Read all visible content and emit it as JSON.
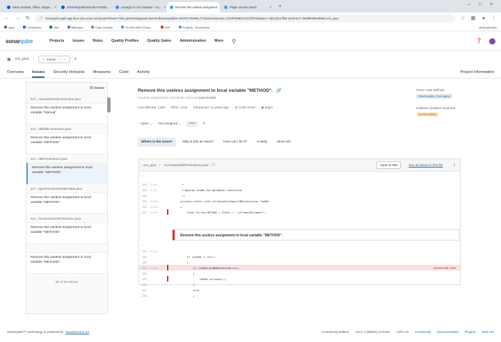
{
  "browser": {
    "tabs": [
      {
        "label": "WEKI Outlook, Office, Skype...",
        "color": "#0b57d0"
      },
      {
        "label": "SONARQUBE-IMAGE-P12654 -",
        "color": "#0b57d0"
      },
      {
        "label": "sonarjdo is not complete - Go...",
        "color": "#4285f4"
      },
      {
        "label": "Remove this useless assignmen...",
        "color": "#4b9fd5"
      },
      {
        "label": "Plugin version matrix",
        "color": "#4b9fd5"
      }
    ],
    "url": "sonarqube.apps.apg-dev1-sp1.amat.com/project/issues?clea=java%20&type&impactSoftwareQualities=MAINTAINABILITY&issueStatuses=CONFIRMED%2COPEN&open=7ab01d12-ffb0-4248-9cc7-35d5bfeb6e88&id=ecs_java",
    "bookmarks": [
      "Apps",
      "Confluence",
      "IAM",
      "Bitbucket",
      "Code Checkin",
      "CLASS MES 5 Dow...",
      "SAP",
      "Projects - SonarQube"
    ],
    "all_bookmarks": "All Bookmarks"
  },
  "sonar": {
    "logo_main": "sonar",
    "logo_accent": "qube",
    "nav": [
      "Projects",
      "Issues",
      "Rules",
      "Quality Profiles",
      "Quality Gates",
      "Administration",
      "More"
    ],
    "project": "ecs_java",
    "branch": "master",
    "project_tabs": [
      "Overview",
      "Issues",
      "Security Hotspots",
      "Measures",
      "Code",
      "Activity"
    ],
    "project_info": "Project Information"
  },
  "sidebar": {
    "count": "93 issues",
    "groups": [
      {
        "file": "src/.../Java/ZSecsIIConnection.java",
        "issue": "Remove this useless assignment to local variable \"interval\"."
      },
      {
        "file": "src/.../db/DBConnection.java",
        "issue": "Remove this useless assignment to local variable \"METHOD\"."
      },
      {
        "file": "src/.../db/Persistence.java",
        "issue": "Remove this useless assignment to local variable \"METHOD\"."
      },
      {
        "file": "src/.../gem/GemEventOBHelper.java",
        "issue": "Remove this useless assignment to local variable \"METHOD\"."
      },
      {
        "file": "src/.../mcs/GenericMCSDevice.java",
        "issue": "Remove this useless assignment to local variable \"METHOD\"."
      },
      {
        "file": "",
        "issue": "Remove this useless assignment to local variable \"METHOD\"."
      }
    ],
    "footer": "93 of 93 shown"
  },
  "issue": {
    "title": "Remove this useless assignment to local variable \"METHOD\".",
    "rule_text": "Unused assignments should be removed",
    "rule_key": "java:S1854",
    "meta": [
      "Line affected: L268",
      "Effort: 1min",
      "Introduced: 12 years ago",
      "Code Smell",
      "Major"
    ],
    "clean_code_label": "Clean code attribute",
    "clean_code_value": "Intentionality | Not logical",
    "sq_label": "Software qualities impacted",
    "sq_value": "Maintainability",
    "status": "Open",
    "assignee": "Not assigned",
    "tag": "cwe",
    "tabs": [
      "Where is the issue?",
      "Why is this an issue?",
      "How can I fix it?",
      "Activity",
      "More info"
    ]
  },
  "code": {
    "path": "ecs_java",
    "file_path": "src/classes/db/Persistence.java",
    "open_ide": "Open in IDE",
    "see_all": "See all issues in this file",
    "message": "Remove this useless assignment to local variable \"METHOD\".",
    "uncovered": "Uncovered code",
    "lines_top": [
      {
        "n": "262",
        "a": "CLIO...",
        "c": "     *",
        "hl": false
      },
      {
        "n": "263",
        "a": "CLIO...",
        "c": "     * @param theDB the database connection",
        "hl": false
      },
      {
        "n": "264",
        "a": "",
        "c": "     */",
        "hl": false
      },
      {
        "n": "265",
        "a": "brett...",
        "c": "    private static void rollbackOrCommit(DBConnection theDB)",
        "hl": false
      },
      {
        "n": "266",
        "a": "CLIO...",
        "c": "    {",
        "hl": false
      },
      {
        "n": "267",
        "a": "CLIO...",
        "c": "        final String METHOD = CLASS + \".rollbackOrCommit\";",
        "hl": false
      }
    ],
    "lines_bottom": [
      {
        "n": "282",
        "a": "CLIO...",
        "c": "",
        "hl": false
      },
      {
        "n": "283",
        "a": "",
        "c": "        if (theDB != null)",
        "hl": false
      },
      {
        "n": "284",
        "a": "",
        "c": "        {",
        "hl": false
      },
      {
        "n": "285",
        "a": "brett...",
        "c": "            if (theDB.didDBDeadlockError)",
        "hl": true
      },
      {
        "n": "286",
        "a": "",
        "c": "            {",
        "hl": false
      },
      {
        "n": "287",
        "a": "",
        "c": "                theDB.rollback();",
        "hl": false
      },
      {
        "n": "288",
        "a": "",
        "c": "            }",
        "hl": false
      },
      {
        "n": "289",
        "a": "",
        "c": "            else",
        "hl": false
      },
      {
        "n": "290",
        "a": "",
        "c": "            {",
        "hl": false
      }
    ]
  },
  "footer": {
    "left": "SonarQube™ technology is powered by",
    "left_link": "SonarSource SA",
    "right": [
      "Community Edition",
      "v10.2.1 (80001) ACTIVE",
      "LGPL v3",
      "Community",
      "Documentation",
      "Plugins",
      "Web API"
    ]
  },
  "colors": {
    "accent": "#236a97",
    "error": "#d02f3a",
    "link": "#4b9fd5"
  }
}
